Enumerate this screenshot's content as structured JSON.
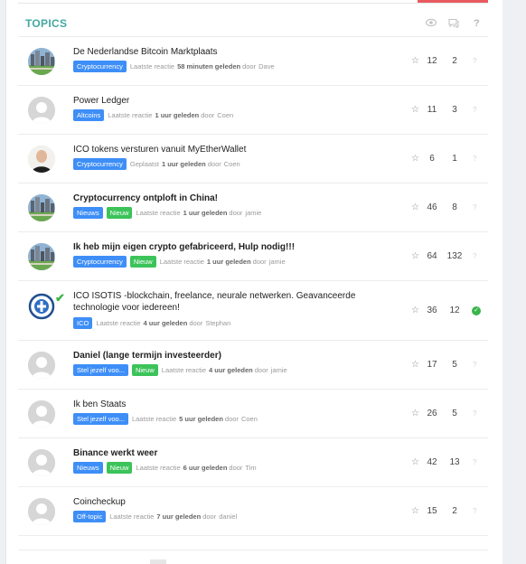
{
  "header": {
    "title": "TOPICS",
    "views_icon": "eye-icon",
    "replies_icon": "comments-icon",
    "status_label": "?"
  },
  "topics": [
    {
      "title": "De Nederlandse Bitcoin Marktplaats",
      "bold": false,
      "avatar": "city-photo",
      "tags": [
        {
          "label": "Cryptocurrency",
          "color": "#3e8ef7"
        }
      ],
      "meta_prefix": "Laatste reactie",
      "time": "58 minuten geleden",
      "by": "door",
      "user": "Dave",
      "stars": "12",
      "replies": "2",
      "status": "?"
    },
    {
      "title": "Power Ledger",
      "bold": false,
      "avatar": "default",
      "tags": [
        {
          "label": "Altcoins",
          "color": "#3e8ef7"
        }
      ],
      "meta_prefix": "Laatste reactie",
      "time": "1 uur geleden",
      "by": "door",
      "user": "Coen",
      "stars": "11",
      "replies": "3",
      "status": "?"
    },
    {
      "title": "ICO tokens versturen vanuit MyEtherWallet",
      "bold": false,
      "avatar": "person-photo",
      "tags": [
        {
          "label": "Cryptocurrency",
          "color": "#3e8ef7"
        }
      ],
      "meta_prefix": "Geplaatst",
      "time": "1 uur geleden",
      "by": "door",
      "user": "Coen",
      "stars": "6",
      "replies": "1",
      "status": "?"
    },
    {
      "title": "Cryptocurrency ontploft in China!",
      "bold": true,
      "avatar": "city-photo",
      "tags": [
        {
          "label": "Nieuws",
          "color": "#3e8ef7"
        },
        {
          "label": "Nieuw",
          "color": "#3cc35a"
        }
      ],
      "meta_prefix": "Laatste reactie",
      "time": "1 uur geleden",
      "by": "door",
      "user": "jamie",
      "stars": "46",
      "replies": "8",
      "status": "?"
    },
    {
      "title": "Ik heb mijn eigen crypto gefabriceerd, Hulp nodig!!!",
      "bold": true,
      "avatar": "city-photo",
      "tags": [
        {
          "label": "Cryptocurrency",
          "color": "#3e8ef7"
        },
        {
          "label": "Nieuw",
          "color": "#3cc35a"
        }
      ],
      "meta_prefix": "Laatste reactie",
      "time": "1 uur geleden",
      "by": "door",
      "user": "jamie",
      "stars": "64",
      "replies": "132",
      "status": "?"
    },
    {
      "title": "ICO ISOTIS -blockchain, freelance, neurale netwerken. Geavanceerde technologie voor iedereen!",
      "bold": false,
      "avatar": "isotis-logo",
      "tags": [
        {
          "label": "ICO",
          "color": "#3e8ef7"
        }
      ],
      "meta_prefix": "Laatste reactie",
      "time": "4 uur geleden",
      "by": "door",
      "user": "Stephan",
      "stars": "36",
      "replies": "12",
      "status": "solved"
    },
    {
      "title": "Daniel (lange termijn investeerder)",
      "bold": true,
      "avatar": "default",
      "tags": [
        {
          "label": "Stel jezelf voo...",
          "color": "#3e8ef7"
        },
        {
          "label": "Nieuw",
          "color": "#3cc35a"
        }
      ],
      "meta_prefix": "Laatste reactie",
      "time": "4 uur geleden",
      "by": "door",
      "user": "jamie",
      "stars": "17",
      "replies": "5",
      "status": "?"
    },
    {
      "title": "Ik ben Staats",
      "bold": false,
      "avatar": "default",
      "tags": [
        {
          "label": "Stel jezelf voo...",
          "color": "#3e8ef7"
        }
      ],
      "meta_prefix": "Laatste reactie",
      "time": "5 uur geleden",
      "by": "door",
      "user": "Coen",
      "stars": "26",
      "replies": "5",
      "status": "?"
    },
    {
      "title": "Binance werkt weer",
      "bold": true,
      "avatar": "default",
      "tags": [
        {
          "label": "Nieuws",
          "color": "#3e8ef7"
        },
        {
          "label": "Nieuw",
          "color": "#3cc35a"
        }
      ],
      "meta_prefix": "Laatste reactie",
      "time": "6 uur geleden",
      "by": "door",
      "user": "Tim",
      "stars": "42",
      "replies": "13",
      "status": "?"
    },
    {
      "title": "Coincheckup",
      "bold": false,
      "avatar": "default",
      "tags": [
        {
          "label": "Off-topic",
          "color": "#3e8ef7"
        }
      ],
      "meta_prefix": "Laatste reactie",
      "time": "7 uur geleden",
      "by": "door",
      "user": "daniel",
      "stars": "15",
      "replies": "2",
      "status": "?"
    }
  ]
}
